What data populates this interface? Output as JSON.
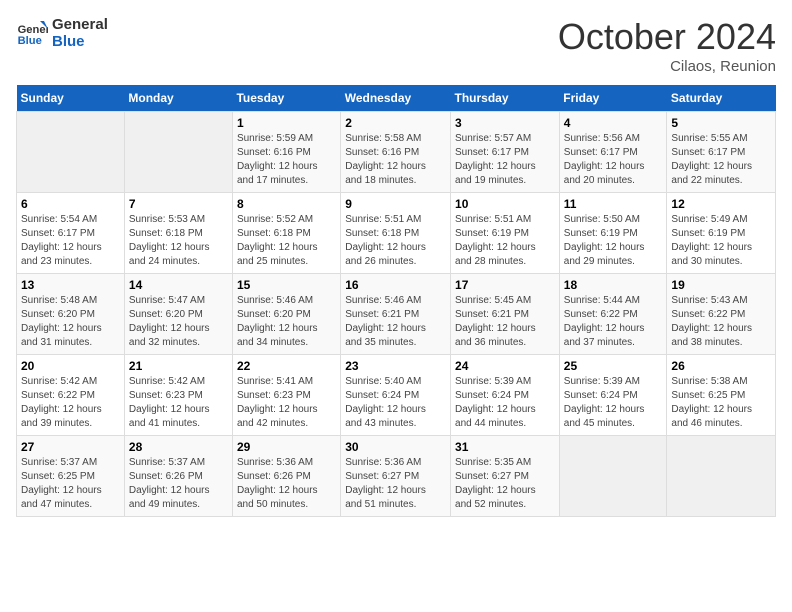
{
  "header": {
    "logo_line1": "General",
    "logo_line2": "Blue",
    "month": "October 2024",
    "location": "Cilaos, Reunion"
  },
  "weekdays": [
    "Sunday",
    "Monday",
    "Tuesday",
    "Wednesday",
    "Thursday",
    "Friday",
    "Saturday"
  ],
  "weeks": [
    [
      {
        "day": "",
        "detail": ""
      },
      {
        "day": "",
        "detail": ""
      },
      {
        "day": "1",
        "detail": "Sunrise: 5:59 AM\nSunset: 6:16 PM\nDaylight: 12 hours\nand 17 minutes."
      },
      {
        "day": "2",
        "detail": "Sunrise: 5:58 AM\nSunset: 6:16 PM\nDaylight: 12 hours\nand 18 minutes."
      },
      {
        "day": "3",
        "detail": "Sunrise: 5:57 AM\nSunset: 6:17 PM\nDaylight: 12 hours\nand 19 minutes."
      },
      {
        "day": "4",
        "detail": "Sunrise: 5:56 AM\nSunset: 6:17 PM\nDaylight: 12 hours\nand 20 minutes."
      },
      {
        "day": "5",
        "detail": "Sunrise: 5:55 AM\nSunset: 6:17 PM\nDaylight: 12 hours\nand 22 minutes."
      }
    ],
    [
      {
        "day": "6",
        "detail": "Sunrise: 5:54 AM\nSunset: 6:17 PM\nDaylight: 12 hours\nand 23 minutes."
      },
      {
        "day": "7",
        "detail": "Sunrise: 5:53 AM\nSunset: 6:18 PM\nDaylight: 12 hours\nand 24 minutes."
      },
      {
        "day": "8",
        "detail": "Sunrise: 5:52 AM\nSunset: 6:18 PM\nDaylight: 12 hours\nand 25 minutes."
      },
      {
        "day": "9",
        "detail": "Sunrise: 5:51 AM\nSunset: 6:18 PM\nDaylight: 12 hours\nand 26 minutes."
      },
      {
        "day": "10",
        "detail": "Sunrise: 5:51 AM\nSunset: 6:19 PM\nDaylight: 12 hours\nand 28 minutes."
      },
      {
        "day": "11",
        "detail": "Sunrise: 5:50 AM\nSunset: 6:19 PM\nDaylight: 12 hours\nand 29 minutes."
      },
      {
        "day": "12",
        "detail": "Sunrise: 5:49 AM\nSunset: 6:19 PM\nDaylight: 12 hours\nand 30 minutes."
      }
    ],
    [
      {
        "day": "13",
        "detail": "Sunrise: 5:48 AM\nSunset: 6:20 PM\nDaylight: 12 hours\nand 31 minutes."
      },
      {
        "day": "14",
        "detail": "Sunrise: 5:47 AM\nSunset: 6:20 PM\nDaylight: 12 hours\nand 32 minutes."
      },
      {
        "day": "15",
        "detail": "Sunrise: 5:46 AM\nSunset: 6:20 PM\nDaylight: 12 hours\nand 34 minutes."
      },
      {
        "day": "16",
        "detail": "Sunrise: 5:46 AM\nSunset: 6:21 PM\nDaylight: 12 hours\nand 35 minutes."
      },
      {
        "day": "17",
        "detail": "Sunrise: 5:45 AM\nSunset: 6:21 PM\nDaylight: 12 hours\nand 36 minutes."
      },
      {
        "day": "18",
        "detail": "Sunrise: 5:44 AM\nSunset: 6:22 PM\nDaylight: 12 hours\nand 37 minutes."
      },
      {
        "day": "19",
        "detail": "Sunrise: 5:43 AM\nSunset: 6:22 PM\nDaylight: 12 hours\nand 38 minutes."
      }
    ],
    [
      {
        "day": "20",
        "detail": "Sunrise: 5:42 AM\nSunset: 6:22 PM\nDaylight: 12 hours\nand 39 minutes."
      },
      {
        "day": "21",
        "detail": "Sunrise: 5:42 AM\nSunset: 6:23 PM\nDaylight: 12 hours\nand 41 minutes."
      },
      {
        "day": "22",
        "detail": "Sunrise: 5:41 AM\nSunset: 6:23 PM\nDaylight: 12 hours\nand 42 minutes."
      },
      {
        "day": "23",
        "detail": "Sunrise: 5:40 AM\nSunset: 6:24 PM\nDaylight: 12 hours\nand 43 minutes."
      },
      {
        "day": "24",
        "detail": "Sunrise: 5:39 AM\nSunset: 6:24 PM\nDaylight: 12 hours\nand 44 minutes."
      },
      {
        "day": "25",
        "detail": "Sunrise: 5:39 AM\nSunset: 6:24 PM\nDaylight: 12 hours\nand 45 minutes."
      },
      {
        "day": "26",
        "detail": "Sunrise: 5:38 AM\nSunset: 6:25 PM\nDaylight: 12 hours\nand 46 minutes."
      }
    ],
    [
      {
        "day": "27",
        "detail": "Sunrise: 5:37 AM\nSunset: 6:25 PM\nDaylight: 12 hours\nand 47 minutes."
      },
      {
        "day": "28",
        "detail": "Sunrise: 5:37 AM\nSunset: 6:26 PM\nDaylight: 12 hours\nand 49 minutes."
      },
      {
        "day": "29",
        "detail": "Sunrise: 5:36 AM\nSunset: 6:26 PM\nDaylight: 12 hours\nand 50 minutes."
      },
      {
        "day": "30",
        "detail": "Sunrise: 5:36 AM\nSunset: 6:27 PM\nDaylight: 12 hours\nand 51 minutes."
      },
      {
        "day": "31",
        "detail": "Sunrise: 5:35 AM\nSunset: 6:27 PM\nDaylight: 12 hours\nand 52 minutes."
      },
      {
        "day": "",
        "detail": ""
      },
      {
        "day": "",
        "detail": ""
      }
    ]
  ]
}
